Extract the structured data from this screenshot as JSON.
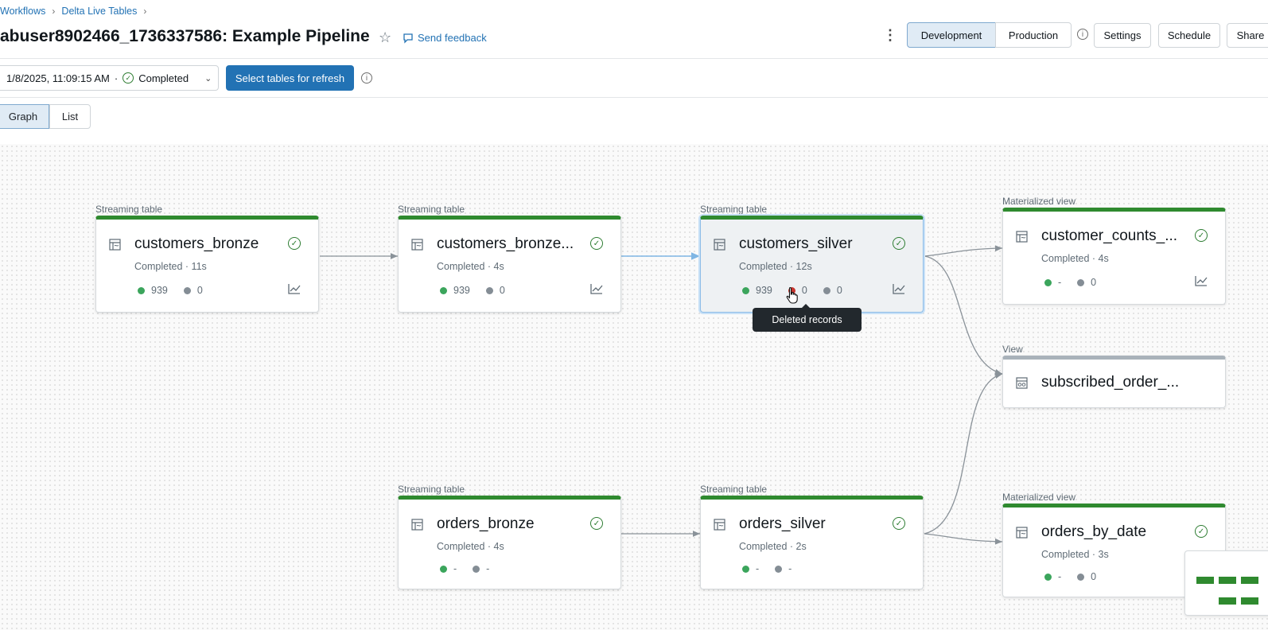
{
  "breadcrumb": [
    "Workflows",
    "Delta Live Tables"
  ],
  "title": "abuser8902466_1736337586: Example Pipeline",
  "feedback": "Send feedback",
  "mode_tabs": [
    "Development",
    "Production"
  ],
  "header_buttons": {
    "settings": "Settings",
    "schedule": "Schedule",
    "share": "Share"
  },
  "run": {
    "timestamp": "1/8/2025, 11:09:15 AM",
    "separator": "·",
    "status": "Completed"
  },
  "refresh_button": "Select tables for refresh",
  "view_tabs": {
    "graph": "Graph",
    "list": "List"
  },
  "nodes": [
    {
      "type": "Streaming table",
      "name": "customers_bronze",
      "status": "Completed · 11s",
      "written": "939",
      "dropped": "0"
    },
    {
      "type": "Streaming table",
      "name": "customers_bronze...",
      "status": "Completed · 4s",
      "written": "939",
      "dropped": "0"
    },
    {
      "type": "Streaming table",
      "name": "customers_silver",
      "status": "Completed · 12s",
      "written": "939",
      "deleted": "0",
      "dropped": "0"
    },
    {
      "type": "Materialized view",
      "name": "customer_counts_...",
      "status": "Completed · 4s",
      "written": "-",
      "dropped": "0"
    },
    {
      "type": "View",
      "name": "subscribed_order_..."
    },
    {
      "type": "Streaming table",
      "name": "orders_bronze",
      "status": "Completed · 4s",
      "written": "-",
      "dropped": "-"
    },
    {
      "type": "Streaming table",
      "name": "orders_silver",
      "status": "Completed · 2s",
      "written": "-",
      "dropped": "-"
    },
    {
      "type": "Materialized view",
      "name": "orders_by_date",
      "status": "Completed · 3s",
      "written": "-",
      "dropped": "0"
    }
  ],
  "tooltip": "Deleted records",
  "colors": {
    "accent": "#2272b4",
    "success": "#2f8a2f",
    "selected_bg": "#e0ebf5"
  }
}
